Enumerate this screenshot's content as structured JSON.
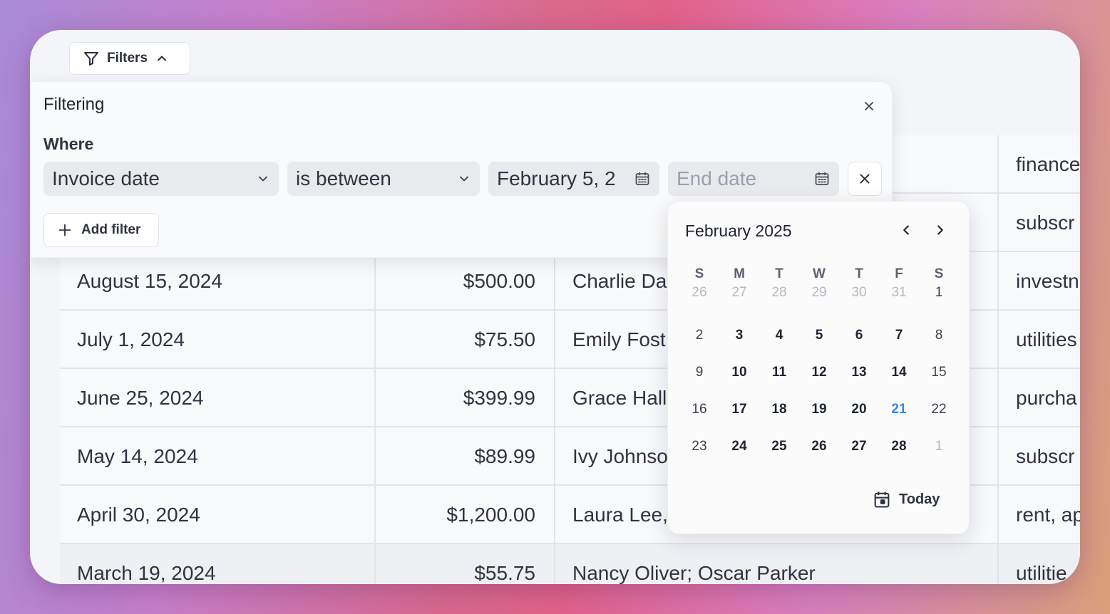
{
  "toolbar": {
    "filters_label": "Filters"
  },
  "filter_panel": {
    "title": "Filtering",
    "where_label": "Where",
    "field_value": "Invoice date",
    "operator_value": "is between",
    "start_date_value": "February 5, 2",
    "end_date_placeholder": "End date",
    "add_filter_label": "Add filter"
  },
  "table": {
    "header_row_visible": [
      "finance",
      "subscr"
    ],
    "rows": [
      {
        "date": "August 15, 2024",
        "amount": "$500.00",
        "name": "Charlie Da",
        "category": "investn"
      },
      {
        "date": "July 1, 2024",
        "amount": "$75.50",
        "name": "Emily Fost",
        "category": "utilities"
      },
      {
        "date": "June 25, 2024",
        "amount": "$399.99",
        "name": "Grace Hall",
        "category": "purcha"
      },
      {
        "date": "May 14, 2024",
        "amount": "$89.99",
        "name": "Ivy Johnso",
        "category": "subscr"
      },
      {
        "date": "April 30, 2024",
        "amount": "$1,200.00",
        "name": "Laura Lee,",
        "category": "rent, ap"
      },
      {
        "date": "March 19, 2024",
        "amount": "$55.75",
        "name": "Nancy Oliver; Oscar Parker",
        "category": "utilitie"
      }
    ]
  },
  "calendar": {
    "month_label": "February 2025",
    "weekdays": [
      "S",
      "M",
      "T",
      "W",
      "T",
      "F",
      "S"
    ],
    "today_day": "21",
    "today_label": "Today",
    "weeks": [
      [
        "26",
        "27",
        "28",
        "29",
        "30",
        "31",
        "1"
      ],
      [
        "2",
        "3",
        "4",
        "5",
        "6",
        "7",
        "8"
      ],
      [
        "9",
        "10",
        "11",
        "12",
        "13",
        "14",
        "15"
      ],
      [
        "16",
        "17",
        "18",
        "19",
        "20",
        "21",
        "22"
      ],
      [
        "23",
        "24",
        "25",
        "26",
        "27",
        "28",
        "1"
      ]
    ],
    "out_of_month": [
      [
        0,
        0
      ],
      [
        0,
        1
      ],
      [
        0,
        2
      ],
      [
        0,
        3
      ],
      [
        0,
        4
      ],
      [
        0,
        5
      ],
      [
        4,
        6
      ]
    ]
  },
  "colors": {
    "today_accent": "#3a86d8"
  }
}
